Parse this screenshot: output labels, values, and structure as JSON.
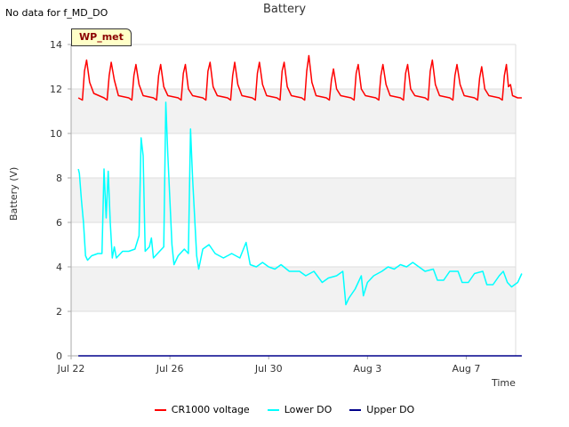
{
  "header": {
    "no_data_note": "No data for f_MD_DO",
    "site_tag": "WP_met"
  },
  "colors": {
    "band": "#f2f2f2",
    "grid": "#dddddd",
    "axis": "#aaaaaa"
  },
  "chart_data": {
    "type": "line",
    "title": "Battery",
    "xlabel": "Time",
    "ylabel": "Battery (V)",
    "ylim": [
      0,
      14
    ],
    "xlim": [
      "2024-07-22",
      "2024-08-09"
    ],
    "grid": "horizontal",
    "shaded_bands": true,
    "legend_position": "bottom-center",
    "y_ticks": [
      0,
      2,
      4,
      6,
      8,
      10,
      12,
      14
    ],
    "x_ticks": [
      {
        "date": "2024-07-22",
        "label": "Jul 22"
      },
      {
        "date": "2024-07-26",
        "label": "Jul 26"
      },
      {
        "date": "2024-07-30",
        "label": "Jul 30"
      },
      {
        "date": "2024-08-03",
        "label": "Aug 3"
      },
      {
        "date": "2024-08-07",
        "label": "Aug 7"
      }
    ],
    "series": [
      {
        "name": "CR1000 voltage",
        "color": "#ff0000",
        "points": [
          [
            "2024-07-22T07:00",
            11.6
          ],
          [
            "2024-07-22T11:00",
            11.5
          ],
          [
            "2024-07-22T13:00",
            12.8
          ],
          [
            "2024-07-22T15:00",
            13.3
          ],
          [
            "2024-07-22T18:00",
            12.3
          ],
          [
            "2024-07-22T22:00",
            11.8
          ],
          [
            "2024-07-23T08:00",
            11.6
          ],
          [
            "2024-07-23T11:00",
            11.5
          ],
          [
            "2024-07-23T13:00",
            12.6
          ],
          [
            "2024-07-23T15:00",
            13.2
          ],
          [
            "2024-07-23T18:00",
            12.4
          ],
          [
            "2024-07-23T22:00",
            11.7
          ],
          [
            "2024-07-24T08:00",
            11.6
          ],
          [
            "2024-07-24T11:00",
            11.5
          ],
          [
            "2024-07-24T13:00",
            12.6
          ],
          [
            "2024-07-24T15:00",
            13.1
          ],
          [
            "2024-07-24T18:00",
            12.2
          ],
          [
            "2024-07-24T22:00",
            11.7
          ],
          [
            "2024-07-25T08:00",
            11.6
          ],
          [
            "2024-07-25T11:00",
            11.5
          ],
          [
            "2024-07-25T13:00",
            12.6
          ],
          [
            "2024-07-25T15:00",
            13.1
          ],
          [
            "2024-07-25T18:00",
            12.1
          ],
          [
            "2024-07-25T22:00",
            11.7
          ],
          [
            "2024-07-26T08:00",
            11.6
          ],
          [
            "2024-07-26T11:00",
            11.5
          ],
          [
            "2024-07-26T13:00",
            12.7
          ],
          [
            "2024-07-26T15:00",
            13.1
          ],
          [
            "2024-07-26T18:00",
            12.0
          ],
          [
            "2024-07-26T22:00",
            11.7
          ],
          [
            "2024-07-27T08:00",
            11.6
          ],
          [
            "2024-07-27T11:00",
            11.5
          ],
          [
            "2024-07-27T13:00",
            12.8
          ],
          [
            "2024-07-27T15:00",
            13.2
          ],
          [
            "2024-07-27T18:00",
            12.1
          ],
          [
            "2024-07-27T22:00",
            11.7
          ],
          [
            "2024-07-28T08:00",
            11.6
          ],
          [
            "2024-07-28T11:00",
            11.5
          ],
          [
            "2024-07-28T13:00",
            12.6
          ],
          [
            "2024-07-28T15:00",
            13.2
          ],
          [
            "2024-07-28T18:00",
            12.2
          ],
          [
            "2024-07-28T22:00",
            11.7
          ],
          [
            "2024-07-29T08:00",
            11.6
          ],
          [
            "2024-07-29T11:00",
            11.5
          ],
          [
            "2024-07-29T13:00",
            12.7
          ],
          [
            "2024-07-29T15:00",
            13.2
          ],
          [
            "2024-07-29T18:00",
            12.2
          ],
          [
            "2024-07-29T22:00",
            11.7
          ],
          [
            "2024-07-30T08:00",
            11.6
          ],
          [
            "2024-07-30T11:00",
            11.5
          ],
          [
            "2024-07-30T13:00",
            12.8
          ],
          [
            "2024-07-30T15:00",
            13.2
          ],
          [
            "2024-07-30T18:00",
            12.1
          ],
          [
            "2024-07-30T22:00",
            11.7
          ],
          [
            "2024-07-31T08:00",
            11.6
          ],
          [
            "2024-07-31T11:00",
            11.5
          ],
          [
            "2024-07-31T13:00",
            12.8
          ],
          [
            "2024-07-31T15:00",
            13.5
          ],
          [
            "2024-07-31T18:00",
            12.3
          ],
          [
            "2024-07-31T22:00",
            11.7
          ],
          [
            "2024-08-01T08:00",
            11.6
          ],
          [
            "2024-08-01T11:00",
            11.5
          ],
          [
            "2024-08-01T13:00",
            12.4
          ],
          [
            "2024-08-01T15:00",
            12.9
          ],
          [
            "2024-08-01T18:00",
            12.0
          ],
          [
            "2024-08-01T22:00",
            11.7
          ],
          [
            "2024-08-02T08:00",
            11.6
          ],
          [
            "2024-08-02T11:00",
            11.5
          ],
          [
            "2024-08-02T13:00",
            12.7
          ],
          [
            "2024-08-02T15:00",
            13.1
          ],
          [
            "2024-08-02T18:00",
            12.0
          ],
          [
            "2024-08-02T22:00",
            11.7
          ],
          [
            "2024-08-03T08:00",
            11.6
          ],
          [
            "2024-08-03T11:00",
            11.5
          ],
          [
            "2024-08-03T13:00",
            12.6
          ],
          [
            "2024-08-03T15:00",
            13.1
          ],
          [
            "2024-08-03T18:00",
            12.2
          ],
          [
            "2024-08-03T22:00",
            11.7
          ],
          [
            "2024-08-04T08:00",
            11.6
          ],
          [
            "2024-08-04T11:00",
            11.5
          ],
          [
            "2024-08-04T13:00",
            12.7
          ],
          [
            "2024-08-04T15:00",
            13.1
          ],
          [
            "2024-08-04T18:00",
            12.0
          ],
          [
            "2024-08-04T22:00",
            11.7
          ],
          [
            "2024-08-05T08:00",
            11.6
          ],
          [
            "2024-08-05T11:00",
            11.5
          ],
          [
            "2024-08-05T13:00",
            12.8
          ],
          [
            "2024-08-05T15:00",
            13.3
          ],
          [
            "2024-08-05T18:00",
            12.2
          ],
          [
            "2024-08-05T22:00",
            11.7
          ],
          [
            "2024-08-06T08:00",
            11.6
          ],
          [
            "2024-08-06T11:00",
            11.5
          ],
          [
            "2024-08-06T13:00",
            12.6
          ],
          [
            "2024-08-06T15:00",
            13.1
          ],
          [
            "2024-08-06T18:00",
            12.2
          ],
          [
            "2024-08-06T22:00",
            11.7
          ],
          [
            "2024-08-07T08:00",
            11.6
          ],
          [
            "2024-08-07T11:00",
            11.5
          ],
          [
            "2024-08-07T13:00",
            12.5
          ],
          [
            "2024-08-07T15:00",
            13.0
          ],
          [
            "2024-08-07T18:00",
            12.0
          ],
          [
            "2024-08-07T22:00",
            11.7
          ],
          [
            "2024-08-08T08:00",
            11.6
          ],
          [
            "2024-08-08T11:00",
            11.5
          ],
          [
            "2024-08-08T13:00",
            12.6
          ],
          [
            "2024-08-08T15:00",
            13.1
          ],
          [
            "2024-08-08T17:00",
            12.1
          ],
          [
            "2024-08-08T19:00",
            12.2
          ],
          [
            "2024-08-08T21:00",
            11.7
          ],
          [
            "2024-08-09T02:00",
            11.6
          ],
          [
            "2024-08-09T06:00",
            11.6
          ]
        ]
      },
      {
        "name": "Lower DO",
        "color": "#00ffff",
        "points": [
          [
            "2024-07-22T07:00",
            8.4
          ],
          [
            "2024-07-22T08:00",
            8.2
          ],
          [
            "2024-07-22T10:00",
            7.0
          ],
          [
            "2024-07-22T12:00",
            6.0
          ],
          [
            "2024-07-22T14:00",
            4.5
          ],
          [
            "2024-07-22T16:00",
            4.3
          ],
          [
            "2024-07-22T20:00",
            4.5
          ],
          [
            "2024-07-23T02:00",
            4.6
          ],
          [
            "2024-07-23T06:00",
            4.6
          ],
          [
            "2024-07-23T08:00",
            8.4
          ],
          [
            "2024-07-23T10:00",
            6.2
          ],
          [
            "2024-07-23T12:00",
            8.3
          ],
          [
            "2024-07-23T14:00",
            6.0
          ],
          [
            "2024-07-23T16:00",
            4.4
          ],
          [
            "2024-07-23T18:00",
            4.9
          ],
          [
            "2024-07-23T20:00",
            4.4
          ],
          [
            "2024-07-24T02:00",
            4.7
          ],
          [
            "2024-07-24T08:00",
            4.7
          ],
          [
            "2024-07-24T14:00",
            4.8
          ],
          [
            "2024-07-24T18:00",
            5.4
          ],
          [
            "2024-07-24T20:00",
            9.8
          ],
          [
            "2024-07-24T22:00",
            9.0
          ],
          [
            "2024-07-25T00:00",
            4.7
          ],
          [
            "2024-07-25T04:00",
            4.9
          ],
          [
            "2024-07-25T06:00",
            5.3
          ],
          [
            "2024-07-25T08:00",
            4.4
          ],
          [
            "2024-07-25T14:00",
            4.7
          ],
          [
            "2024-07-25T18:00",
            4.9
          ],
          [
            "2024-07-25T20:00",
            11.4
          ],
          [
            "2024-07-25T22:00",
            9.0
          ],
          [
            "2024-07-26T02:00",
            5.0
          ],
          [
            "2024-07-26T04:00",
            4.1
          ],
          [
            "2024-07-26T08:00",
            4.5
          ],
          [
            "2024-07-26T14:00",
            4.8
          ],
          [
            "2024-07-26T18:00",
            4.6
          ],
          [
            "2024-07-26T20:00",
            10.2
          ],
          [
            "2024-07-26T22:00",
            8.0
          ],
          [
            "2024-07-27T02:00",
            4.5
          ],
          [
            "2024-07-27T04:00",
            3.9
          ],
          [
            "2024-07-27T08:00",
            4.8
          ],
          [
            "2024-07-27T14:00",
            5.0
          ],
          [
            "2024-07-27T20:00",
            4.6
          ],
          [
            "2024-07-28T04:00",
            4.4
          ],
          [
            "2024-07-28T12:00",
            4.6
          ],
          [
            "2024-07-28T20:00",
            4.4
          ],
          [
            "2024-07-29T02:00",
            5.1
          ],
          [
            "2024-07-29T06:00",
            4.1
          ],
          [
            "2024-07-29T12:00",
            4.0
          ],
          [
            "2024-07-29T18:00",
            4.2
          ],
          [
            "2024-07-30T00:00",
            4.0
          ],
          [
            "2024-07-30T06:00",
            3.9
          ],
          [
            "2024-07-30T12:00",
            4.1
          ],
          [
            "2024-07-30T20:00",
            3.8
          ],
          [
            "2024-07-31T06:00",
            3.8
          ],
          [
            "2024-07-31T12:00",
            3.6
          ],
          [
            "2024-07-31T20:00",
            3.8
          ],
          [
            "2024-08-01T04:00",
            3.3
          ],
          [
            "2024-08-01T10:00",
            3.5
          ],
          [
            "2024-08-01T18:00",
            3.6
          ],
          [
            "2024-08-02T00:00",
            3.8
          ],
          [
            "2024-08-02T03:00",
            2.3
          ],
          [
            "2024-08-02T06:00",
            2.6
          ],
          [
            "2024-08-02T12:00",
            3.0
          ],
          [
            "2024-08-02T18:00",
            3.6
          ],
          [
            "2024-08-02T20:00",
            2.7
          ],
          [
            "2024-08-03T00:00",
            3.3
          ],
          [
            "2024-08-03T06:00",
            3.6
          ],
          [
            "2024-08-03T14:00",
            3.8
          ],
          [
            "2024-08-03T20:00",
            4.0
          ],
          [
            "2024-08-04T02:00",
            3.9
          ],
          [
            "2024-08-04T08:00",
            4.1
          ],
          [
            "2024-08-04T14:00",
            4.0
          ],
          [
            "2024-08-04T20:00",
            4.2
          ],
          [
            "2024-08-05T02:00",
            4.0
          ],
          [
            "2024-08-05T08:00",
            3.8
          ],
          [
            "2024-08-05T16:00",
            3.9
          ],
          [
            "2024-08-05T20:00",
            3.4
          ],
          [
            "2024-08-06T02:00",
            3.4
          ],
          [
            "2024-08-06T08:00",
            3.8
          ],
          [
            "2024-08-06T16:00",
            3.8
          ],
          [
            "2024-08-06T20:00",
            3.3
          ],
          [
            "2024-08-07T02:00",
            3.3
          ],
          [
            "2024-08-07T08:00",
            3.7
          ],
          [
            "2024-08-07T16:00",
            3.8
          ],
          [
            "2024-08-07T20:00",
            3.2
          ],
          [
            "2024-08-08T02:00",
            3.2
          ],
          [
            "2024-08-08T08:00",
            3.6
          ],
          [
            "2024-08-08T12:00",
            3.8
          ],
          [
            "2024-08-08T16:00",
            3.3
          ],
          [
            "2024-08-08T20:00",
            3.1
          ],
          [
            "2024-08-09T02:00",
            3.3
          ],
          [
            "2024-08-09T06:00",
            3.7
          ]
        ]
      },
      {
        "name": "Upper DO",
        "color": "#00008b",
        "points": [
          [
            "2024-07-22T07:00",
            0.0
          ],
          [
            "2024-08-09T06:00",
            0.0
          ]
        ]
      }
    ]
  }
}
